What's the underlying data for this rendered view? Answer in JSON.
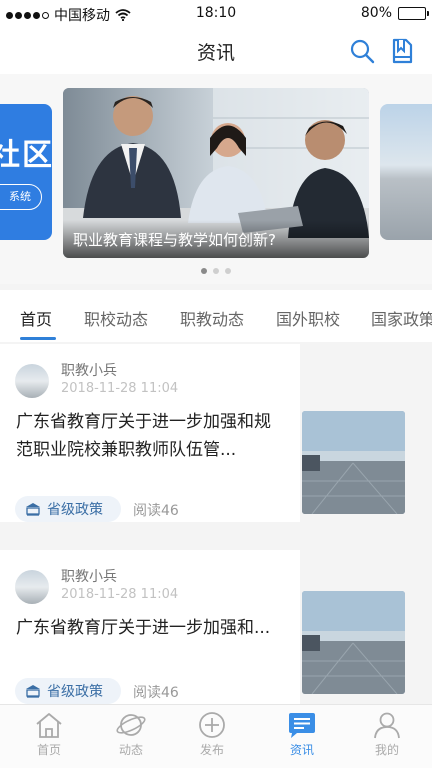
{
  "status_bar": {
    "carrier": "中国移动",
    "time": "18:10",
    "battery": "80%",
    "battery_level": 0.8
  },
  "header": {
    "title": "资讯",
    "search_icon": "search-icon",
    "book_icon": "book-icon"
  },
  "banner": {
    "left_slide_text": "社区",
    "left_slide_pill": "系统",
    "main_caption": "职业教育课程与教学如何创新?",
    "slide_count": 3,
    "active_slide": 1
  },
  "tabs": [
    {
      "label": "首页",
      "active": true
    },
    {
      "label": "职校动态",
      "active": false
    },
    {
      "label": "职教动态",
      "active": false
    },
    {
      "label": "国外职校",
      "active": false
    },
    {
      "label": "国家政策",
      "active": false
    }
  ],
  "articles": [
    {
      "author": "职教小兵",
      "date": "2018-11-28 11:04",
      "title": "广东省教育厅关于进一步加强和规范职业院校兼职教师队伍管...",
      "tag": "省级政策",
      "reads": "阅读46"
    },
    {
      "author": "职教小兵",
      "date": "2018-11-28 11:04",
      "title": "广东省教育厅关于进一步加强和...",
      "tag": "省级政策",
      "reads": "阅读46"
    }
  ],
  "bottom_nav": [
    {
      "label": "首页",
      "icon": "home-icon",
      "active": false
    },
    {
      "label": "动态",
      "icon": "planet-icon",
      "active": false
    },
    {
      "label": "发布",
      "icon": "plus-circle-icon",
      "active": false
    },
    {
      "label": "资讯",
      "icon": "news-icon",
      "active": true
    },
    {
      "label": "我的",
      "icon": "user-icon",
      "active": false
    }
  ],
  "colors": {
    "accent": "#2f80d8",
    "banner_blue": "#2f7de1",
    "tag_text": "#3a6ea5"
  }
}
